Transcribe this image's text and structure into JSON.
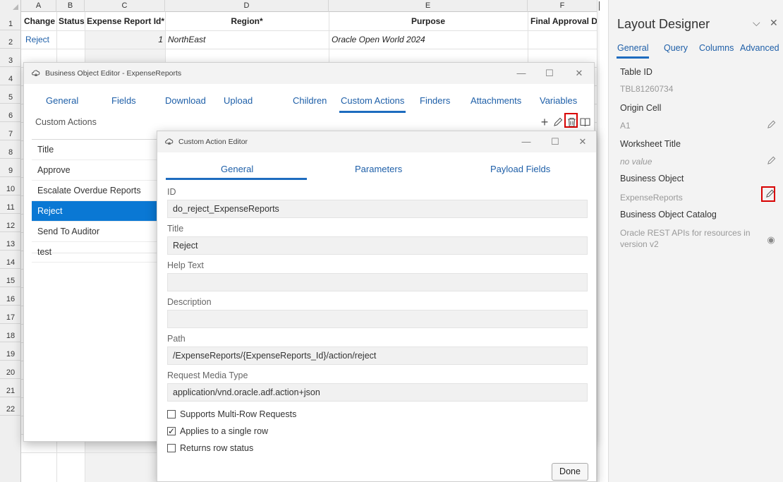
{
  "sheet": {
    "columns": [
      "A",
      "B",
      "C",
      "D",
      "E",
      "F"
    ],
    "rows": [
      "1",
      "2",
      "3",
      "4",
      "5",
      "6",
      "7",
      "8",
      "9",
      "10",
      "11",
      "12",
      "13",
      "14",
      "15",
      "16",
      "17",
      "18",
      "19",
      "20",
      "21",
      "22"
    ],
    "header_row": {
      "change": "Change",
      "status": "Status",
      "expense_report_id": "Expense Report Id*",
      "region": "Region*",
      "purpose": "Purpose",
      "final_approval": "Final Approval D"
    },
    "data_row": {
      "change": "Reject",
      "expense_report_id": "1",
      "region": "NorthEast",
      "purpose": "Oracle Open World 2024"
    }
  },
  "bo_editor": {
    "title": "Business Object Editor - ExpenseReports",
    "tabs": [
      "General",
      "Fields",
      "Download",
      "Upload",
      "Children",
      "Custom Actions",
      "Finders",
      "Attachments",
      "Variables"
    ],
    "active_tab": "Custom Actions",
    "section_label": "Custom Actions",
    "list_header": "Title",
    "items": [
      "Approve",
      "Escalate Overdue Reports",
      "Reject",
      "Send To Auditor",
      "test"
    ],
    "selected": "Reject",
    "icons": {
      "add": "plus-icon",
      "edit": "pencil-icon",
      "delete": "trash-icon",
      "docs": "book-icon"
    }
  },
  "action_editor": {
    "title": "Custom Action Editor",
    "tabs": [
      "General",
      "Parameters",
      "Payload Fields"
    ],
    "active_tab": "General",
    "fields": {
      "id_label": "ID",
      "id_value": "do_reject_ExpenseReports",
      "title_label": "Title",
      "title_value": "Reject",
      "help_label": "Help Text",
      "help_value": "",
      "description_label": "Description",
      "description_value": "",
      "path_label": "Path",
      "path_value": "/ExpenseReports/{ExpenseReports_Id}/action/reject",
      "media_label": "Request Media Type",
      "media_value": "application/vnd.oracle.adf.action+json"
    },
    "checkboxes": [
      {
        "label": "Supports Multi-Row Requests",
        "checked": false
      },
      {
        "label": "Applies to a single row",
        "checked": true
      },
      {
        "label": "Returns row status",
        "checked": false
      }
    ],
    "done_label": "Done"
  },
  "layout_designer": {
    "title": "Layout Designer",
    "tabs": [
      "General",
      "Query",
      "Columns",
      "Advanced"
    ],
    "active_tab": "General",
    "props": {
      "table_id_label": "Table ID",
      "table_id_value": "TBL81260734",
      "origin_label": "Origin Cell",
      "origin_value": "A1",
      "ws_title_label": "Worksheet Title",
      "ws_title_value": "no value",
      "bo_label": "Business Object",
      "bo_value": "ExpenseReports",
      "catalog_label": "Business Object Catalog",
      "catalog_value": "Oracle REST APIs for resources in version v2"
    }
  },
  "colors": {
    "accent": "#1e6cbf",
    "selection": "#0a78d4",
    "highlight_box": "#d80000"
  }
}
